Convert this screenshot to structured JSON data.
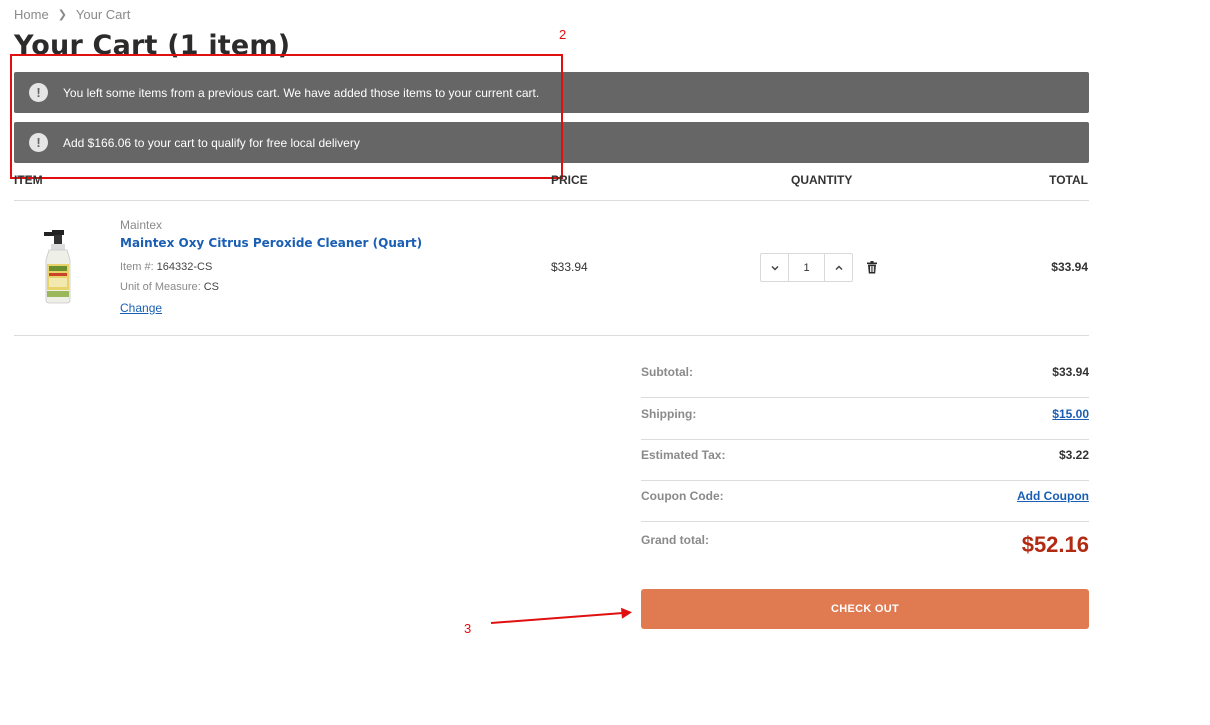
{
  "breadcrumb": {
    "home": "Home",
    "current": "Your Cart"
  },
  "page": {
    "title": "Your Cart (1 item)"
  },
  "notices": [
    {
      "text": "You left some items from a previous cart. We have added those items to your current cart."
    },
    {
      "text": "Add $166.06 to your cart to qualify for free local delivery"
    }
  ],
  "annotations": {
    "box_label": "2",
    "arrow_label": "3",
    "color": "#e01010"
  },
  "table": {
    "headers": {
      "item": "ITEM",
      "price": "PRICE",
      "quantity": "QUANTITY",
      "total": "TOTAL"
    }
  },
  "item": {
    "brand": "Maintex",
    "name": "Maintex Oxy Citrus Peroxide Cleaner (Quart)",
    "item_no_label": "Item #:",
    "item_no": "164332-CS",
    "uom_label": "Unit of Measure:",
    "uom": "CS",
    "change_label": "Change",
    "price": "$33.94",
    "quantity": "1",
    "total": "$33.94"
  },
  "summary": {
    "subtotal_label": "Subtotal:",
    "subtotal": "$33.94",
    "shipping_label": "Shipping:",
    "shipping": "$15.00",
    "tax_label": "Estimated Tax:",
    "tax": "$3.22",
    "coupon_label": "Coupon Code:",
    "coupon_link": "Add Coupon",
    "grand_label": "Grand total:",
    "grand": "$52.16"
  },
  "checkout_label": "CHECK OUT",
  "colors": {
    "notice_bg": "#666666",
    "link": "#1a5fb4",
    "grand_total": "#b22a12",
    "checkout_bg": "#e07a50"
  }
}
